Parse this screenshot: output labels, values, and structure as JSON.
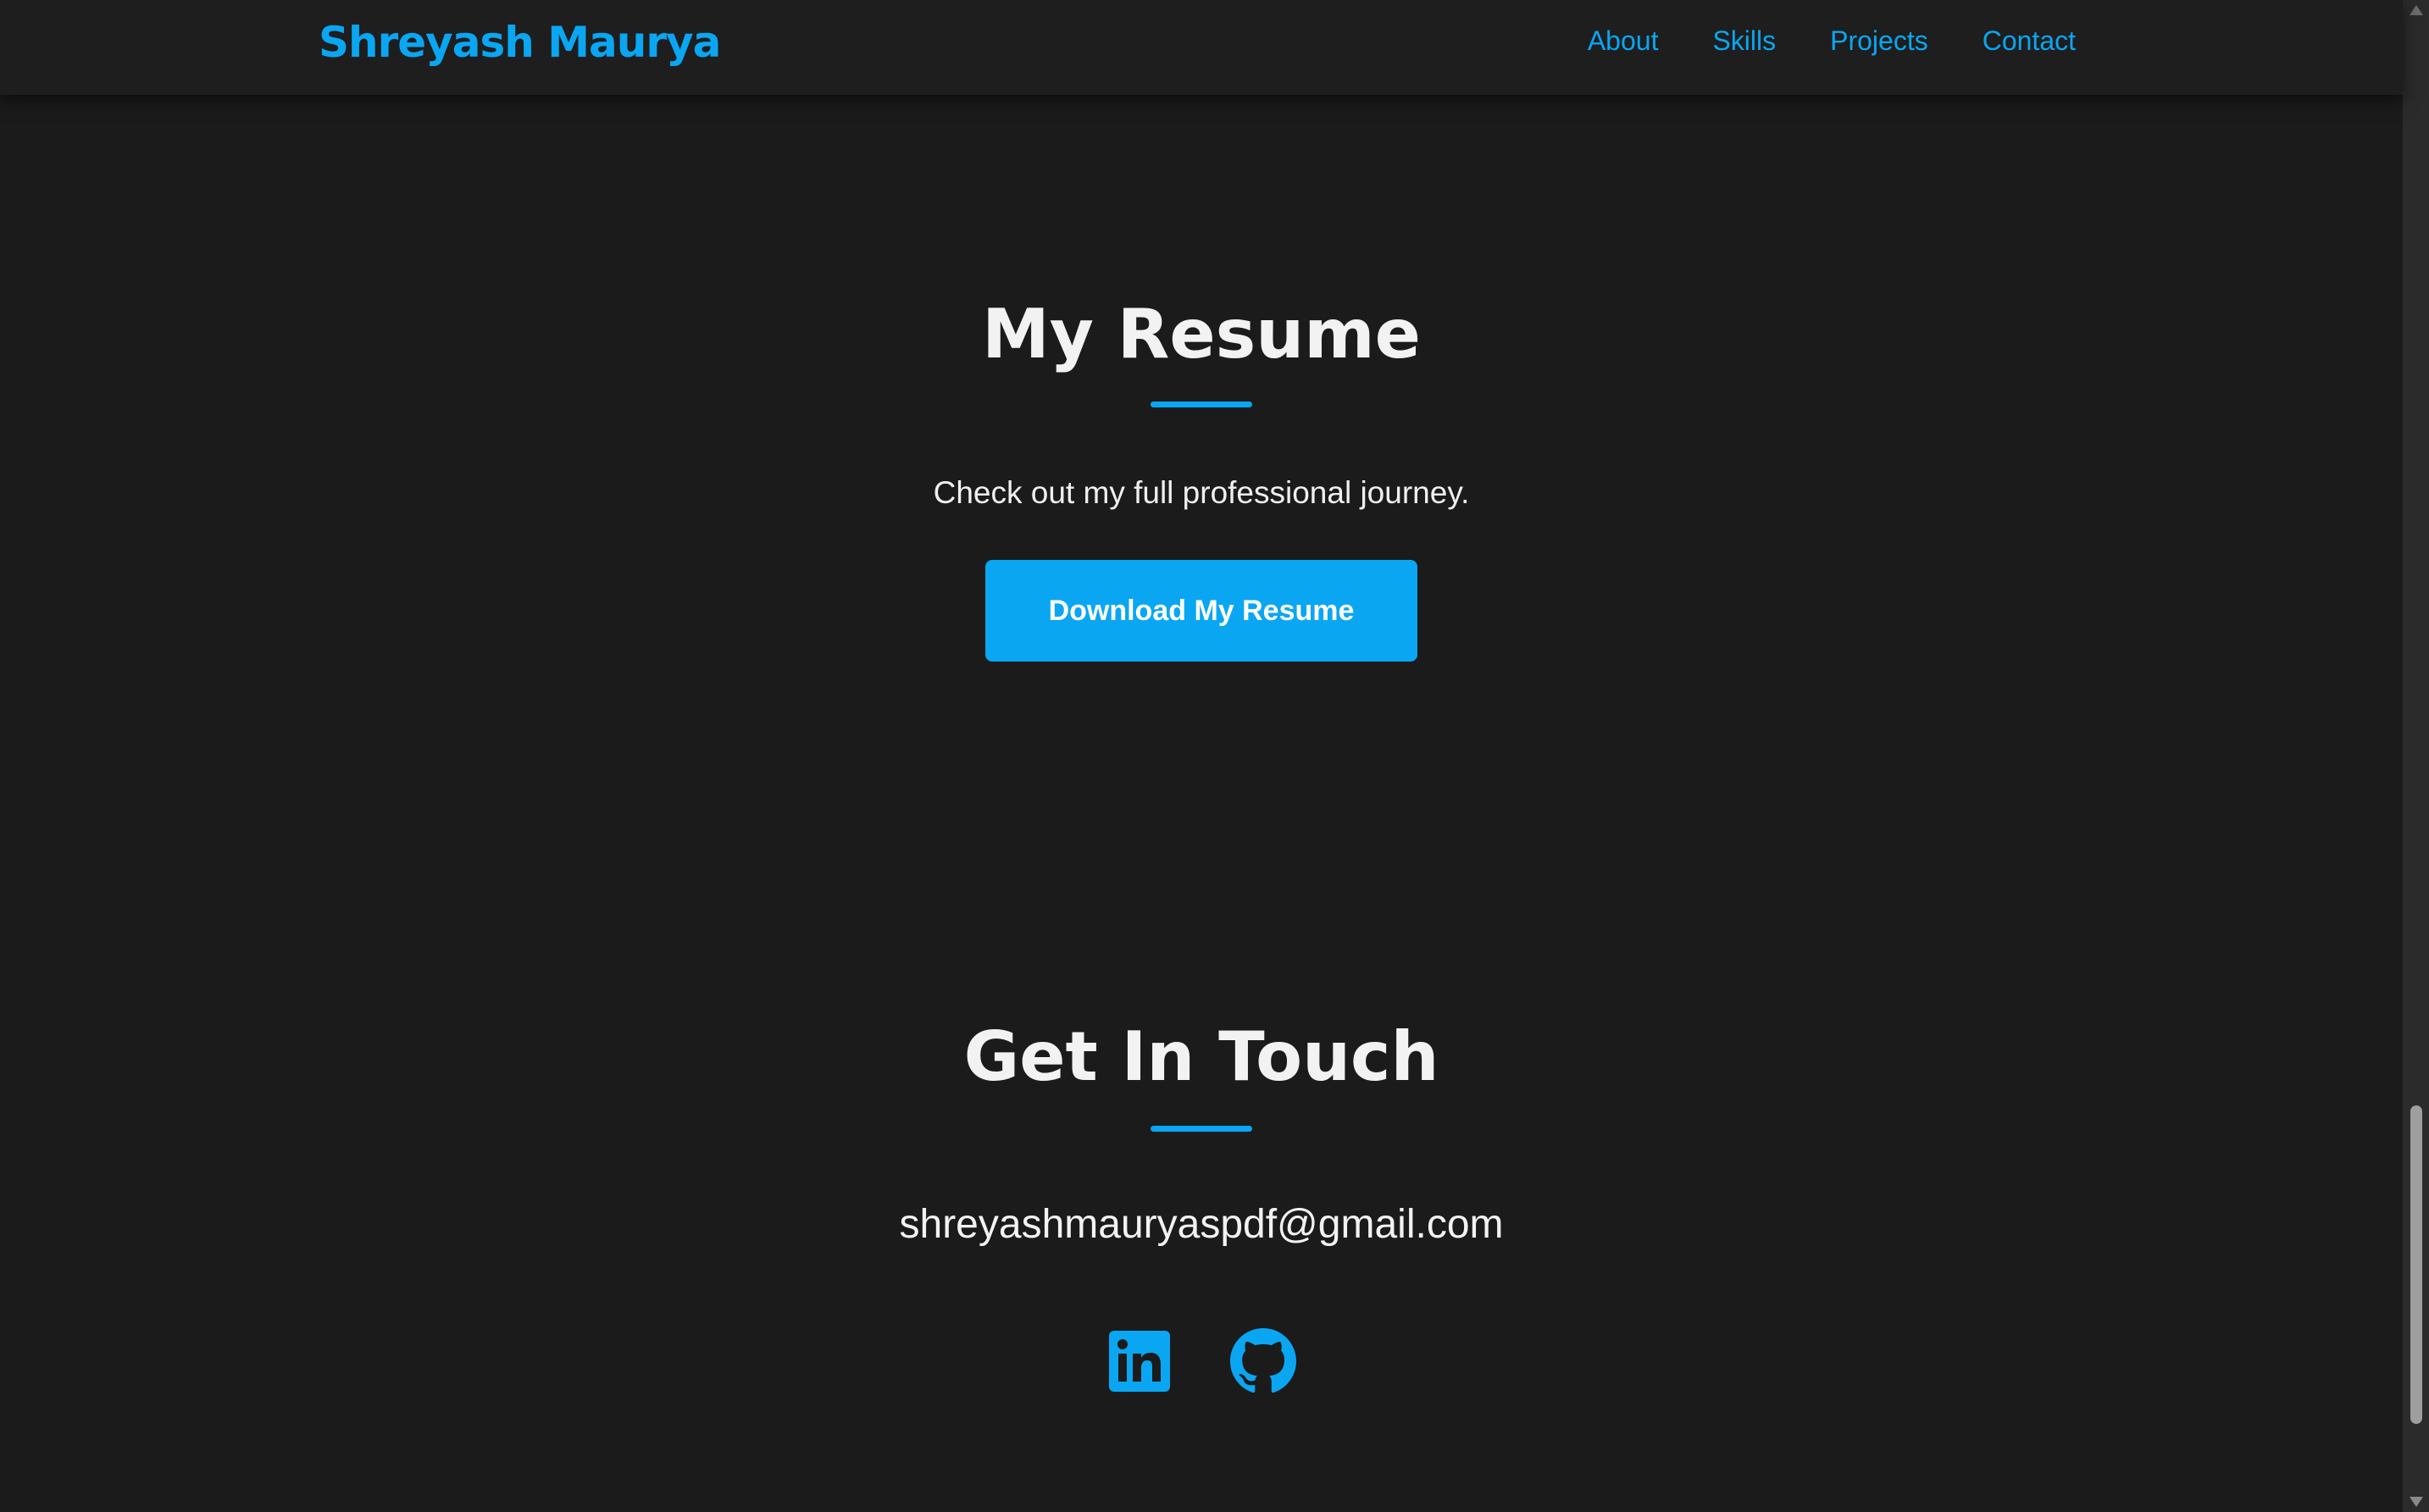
{
  "header": {
    "brand": "Shreyash Maurya",
    "nav": [
      {
        "label": "About"
      },
      {
        "label": "Skills"
      },
      {
        "label": "Projects"
      },
      {
        "label": "Contact"
      }
    ]
  },
  "resume": {
    "title": "My Resume",
    "subtitle": "Check out my full professional journey.",
    "button_label": "Download My Resume"
  },
  "contact": {
    "title": "Get In Touch",
    "email": "shreyashmauryaspdf@gmail.com",
    "socials": [
      {
        "icon": "linkedin-icon"
      },
      {
        "icon": "github-icon"
      }
    ]
  },
  "colors": {
    "accent": "#0aa6f2",
    "background": "#1b1b1b",
    "header_background": "#1e1e1e",
    "text": "#f2f2f2"
  }
}
